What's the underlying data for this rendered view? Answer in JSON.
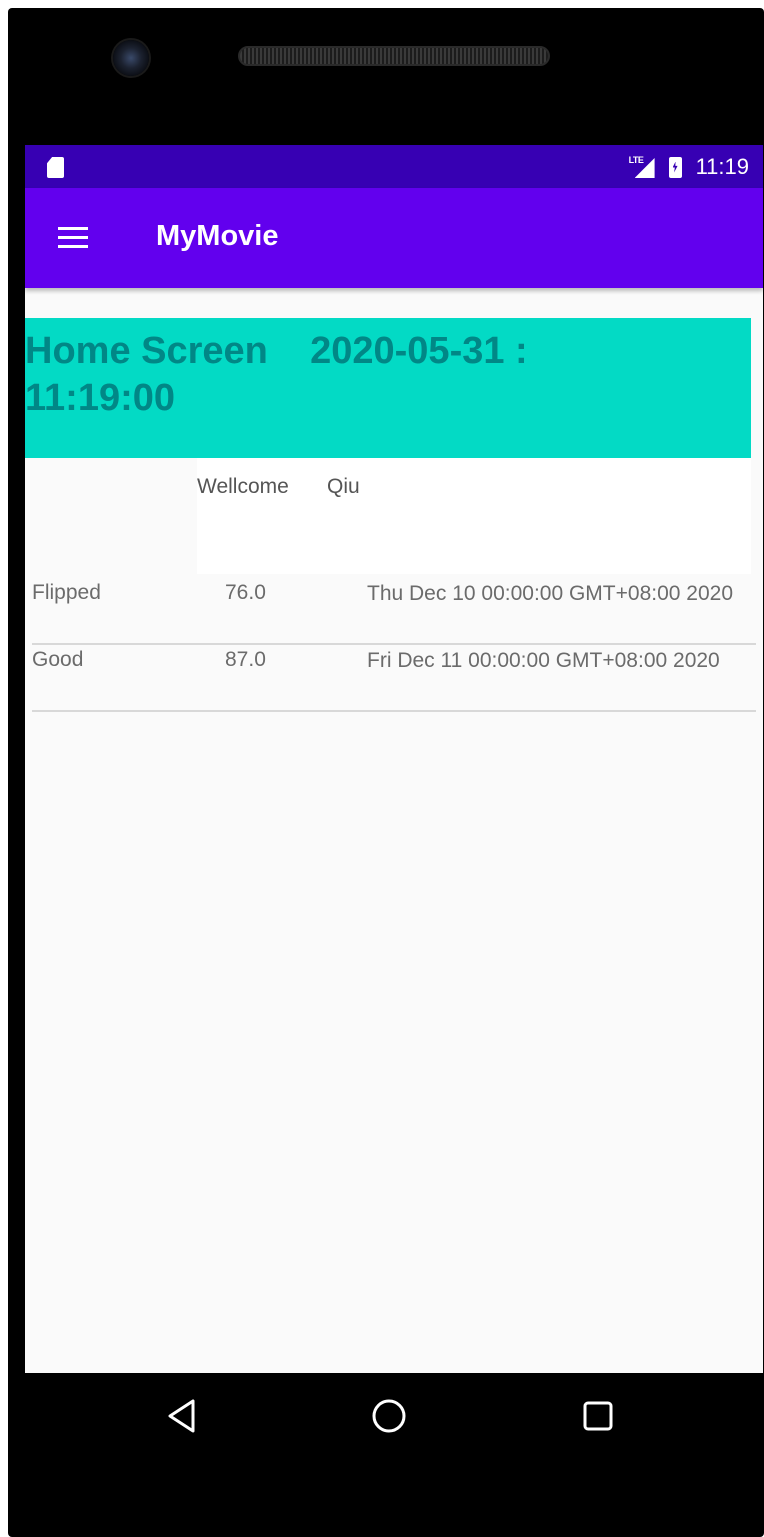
{
  "status_bar": {
    "network_label": "LTE",
    "time": "11:19"
  },
  "app_bar": {
    "title": "MyMovie",
    "menu_icon": "hamburger-menu-icon"
  },
  "banner": {
    "text": "Home Screen    2020-05-31 :\n11:19:00",
    "background_color": "#03dac5",
    "text_color": "#018786"
  },
  "welcome": {
    "greeting": "Wellcome",
    "user_name": "Qiu"
  },
  "movies": [
    {
      "name": "Flipped",
      "score": "76.0",
      "date": "Thu Dec 10 00:00:00 GMT+08:00 2020"
    },
    {
      "name": "Good",
      "score": "87.0",
      "date": "Fri Dec 11 00:00:00 GMT+08:00 2020"
    }
  ],
  "nav_bar": {
    "back_icon": "back-triangle-icon",
    "home_icon": "home-circle-icon",
    "recents_icon": "recents-square-icon"
  },
  "colors": {
    "status_bar": "#3700b3",
    "app_bar": "#6200ee"
  }
}
